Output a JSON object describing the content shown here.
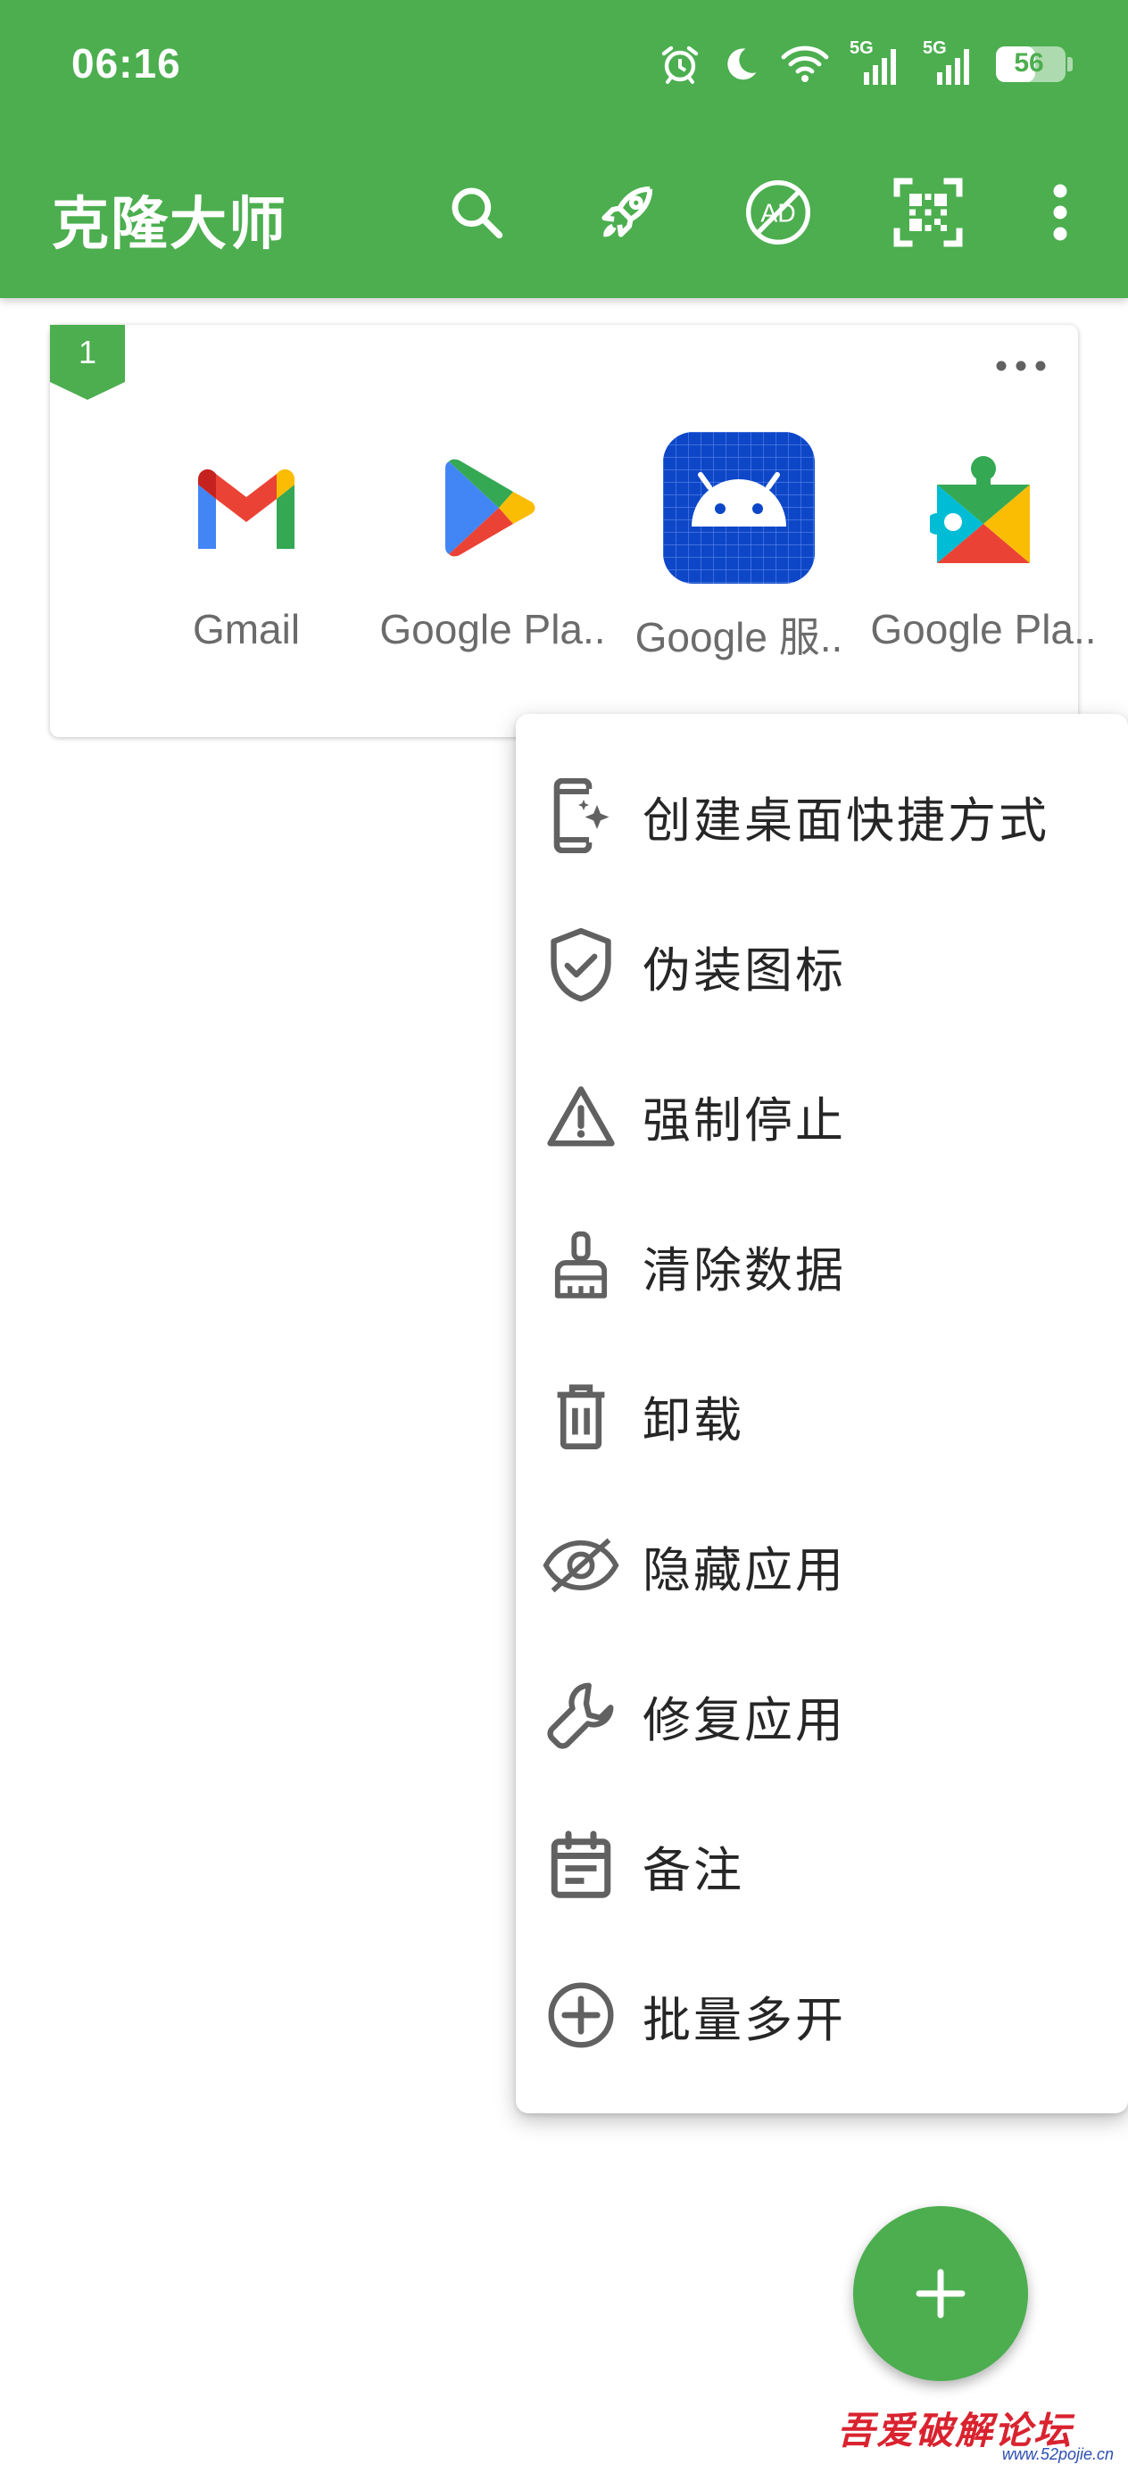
{
  "status_bar": {
    "time": "06:16",
    "battery": "56",
    "network_1": "5G",
    "network_2": "5G",
    "icons": [
      "alarm-icon",
      "moon-icon",
      "wifi-icon",
      "signal-icon",
      "signal-icon",
      "battery-icon"
    ]
  },
  "app_bar": {
    "title": "克隆大师",
    "actions": [
      "search-icon",
      "rocket-icon",
      "no-ad-icon",
      "qr-scan-icon",
      "more-vert-icon"
    ],
    "color": "#4cae4f"
  },
  "group_card": {
    "badge": "1",
    "apps": [
      {
        "label": "Gmail",
        "icon": "gmail-icon"
      },
      {
        "label": "Google Pla..",
        "icon": "google-play-store-icon"
      },
      {
        "label": "Google 服..",
        "icon": "android-icon"
      },
      {
        "label": "Google Pla..",
        "icon": "google-play-services-icon"
      }
    ]
  },
  "menu": {
    "items": [
      {
        "label": "创建桌面快捷方式",
        "icon": "shortcut-icon"
      },
      {
        "label": "伪装图标",
        "icon": "shield-check-icon"
      },
      {
        "label": "强制停止",
        "icon": "warning-icon"
      },
      {
        "label": "清除数据",
        "icon": "broom-icon"
      },
      {
        "label": "卸载",
        "icon": "trash-icon"
      },
      {
        "label": "隐藏应用",
        "icon": "eye-off-icon"
      },
      {
        "label": "修复应用",
        "icon": "wrench-icon"
      },
      {
        "label": "备注",
        "icon": "calendar-note-icon"
      },
      {
        "label": "批量多开",
        "icon": "plus-circle-icon"
      }
    ]
  },
  "fab": {
    "icon": "plus-icon"
  },
  "watermark": {
    "text": "吾爱破解论坛",
    "url": "www.52pojie.cn"
  }
}
